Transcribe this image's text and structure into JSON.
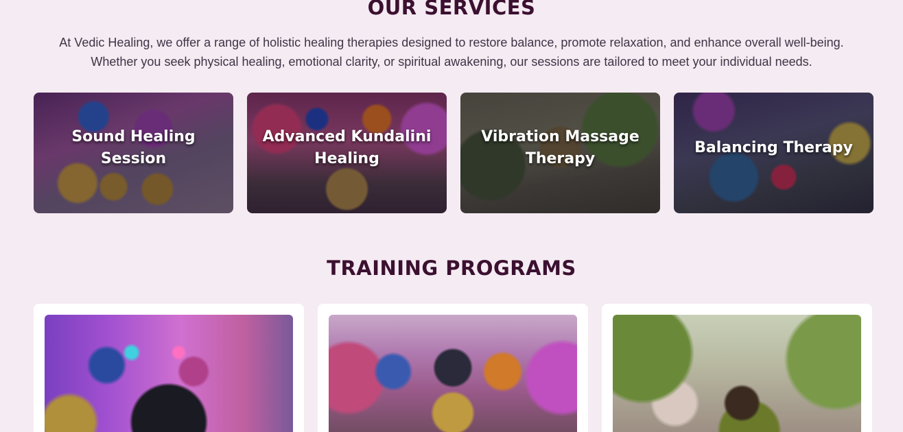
{
  "services": {
    "title": "OUR SERVICES",
    "intro_line1": "At Vedic Healing, we offer a range of holistic healing therapies designed to restore balance, promote relaxation, and enhance overall well-being.",
    "intro_line2": "Whether you seek physical healing, emotional clarity, or spiritual awakening, our sessions are tailored to meet your individual needs.",
    "cards": [
      {
        "label": "Sound Healing Session"
      },
      {
        "label": "Advanced Kundalini Healing"
      },
      {
        "label": "Vibration Massage Therapy"
      },
      {
        "label": "Balancing Therapy"
      }
    ]
  },
  "training": {
    "title": "TRAINING PROGRAMS"
  },
  "colors": {
    "background": "#f5ebf2",
    "heading": "#3b1030",
    "body_text": "#3d3447",
    "card_background": "#ffffff"
  }
}
